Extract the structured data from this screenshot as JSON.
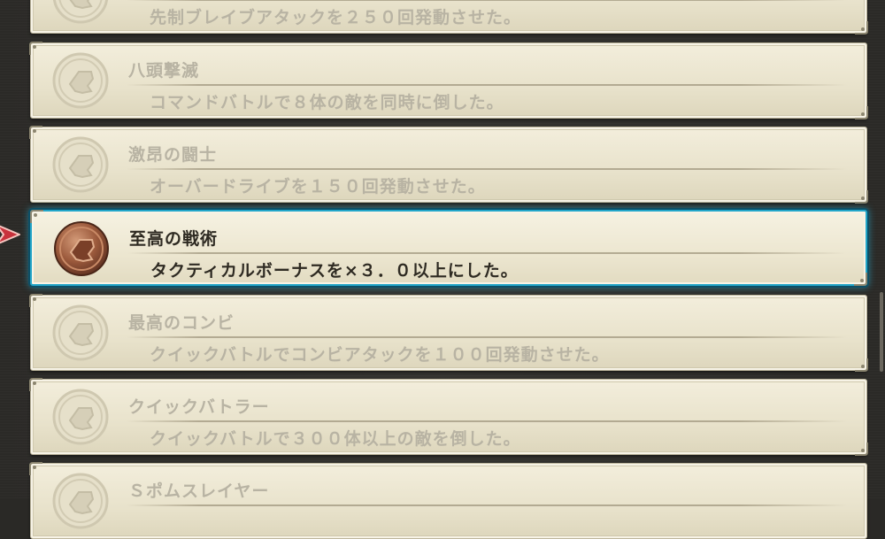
{
  "achievements": [
    {
      "title": "",
      "description": "先制ブレイブアタックを２５０回発動させた。",
      "selected": false
    },
    {
      "title": "八頭撃滅",
      "description": "コマンドバトルで８体の敵を同時に倒した。",
      "selected": false
    },
    {
      "title": "激昂の闘士",
      "description": "オーバードライブを１５０回発動させた。",
      "selected": false
    },
    {
      "title": "至高の戦術",
      "description": "タクティカルボーナスを×３．０以上にした。",
      "selected": true
    },
    {
      "title": "最高のコンビ",
      "description": "クイックバトルでコンビアタックを１００回発動させた。",
      "selected": false
    },
    {
      "title": "クイックバトラー",
      "description": "クイックバトルで３００体以上の敵を倒した。",
      "selected": false
    },
    {
      "title": "Ｓポムスレイヤー",
      "description": "",
      "selected": false
    }
  ],
  "colors": {
    "selection_border": "#22a6c9",
    "medal_bronze": "#9c5a3c",
    "medal_locked": "#d9d3bf",
    "cursor": "#c8323c"
  },
  "icons": {
    "medal": "fist-medal-icon",
    "cursor": "arrow-cursor-icon",
    "corner": "ornament-corner-icon"
  }
}
